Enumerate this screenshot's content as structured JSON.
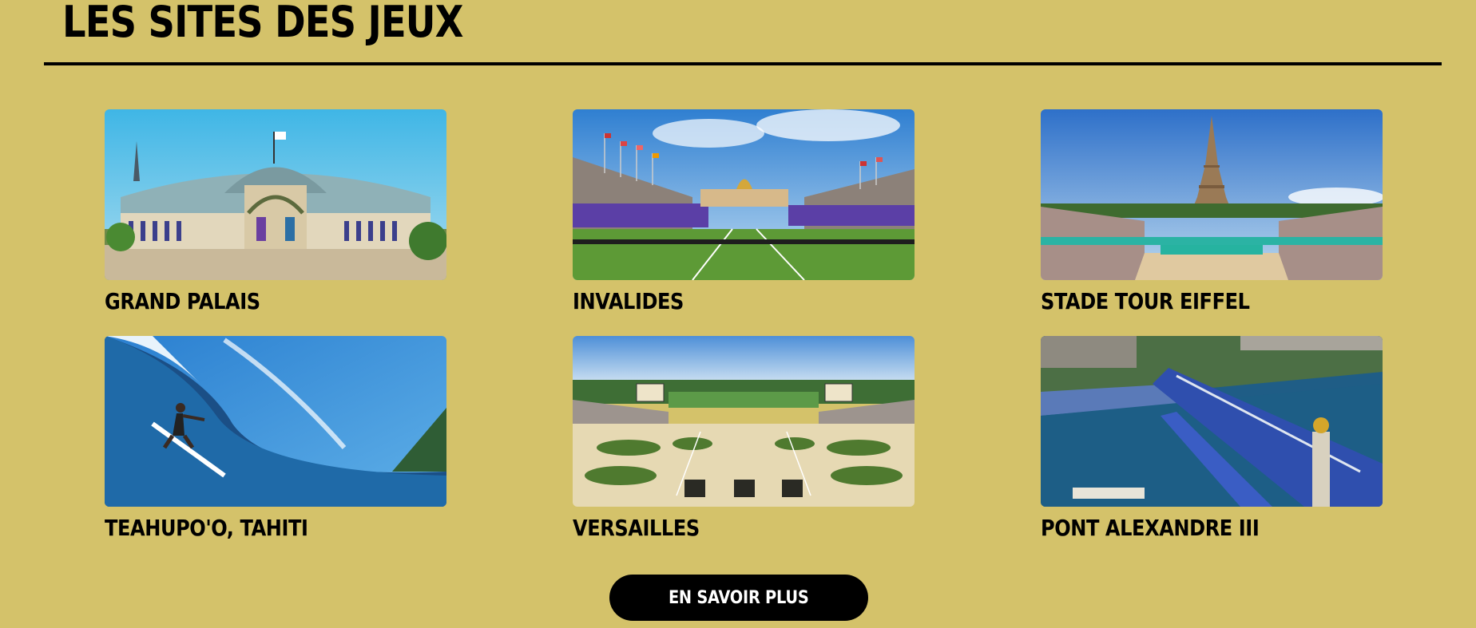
{
  "section": {
    "title": "LES SITES DES JEUX",
    "accent_color": "#d4c26a"
  },
  "venues": [
    {
      "label": "GRAND PALAIS",
      "image": "grand-palais-photo"
    },
    {
      "label": "INVALIDES",
      "image": "invalides-photo"
    },
    {
      "label": "STADE TOUR EIFFEL",
      "image": "eiffel-tower-stadium-photo"
    },
    {
      "label": "TEAHUPO'O, TAHITI",
      "image": "teahupoo-surf-photo"
    },
    {
      "label": "VERSAILLES",
      "image": "versailles-equestrian-photo"
    },
    {
      "label": "PONT ALEXANDRE III",
      "image": "pont-alexandre-photo"
    }
  ],
  "cta": {
    "label": "EN SAVOIR PLUS"
  }
}
